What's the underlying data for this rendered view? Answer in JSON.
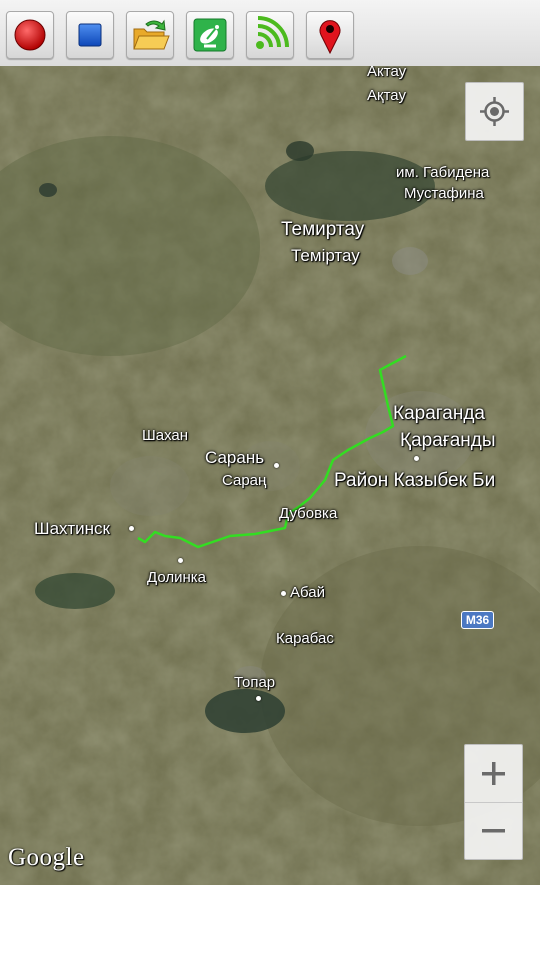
{
  "toolbar": {
    "buttons": [
      {
        "name": "record-button",
        "icon": "record-icon"
      },
      {
        "name": "stop-button",
        "icon": "stop-icon"
      },
      {
        "name": "open-folder-button",
        "icon": "open-folder-icon"
      },
      {
        "name": "satellite-button",
        "icon": "satellite-icon"
      },
      {
        "name": "signal-button",
        "icon": "wifi-signal-icon"
      },
      {
        "name": "location-pin-button",
        "icon": "map-pin-icon"
      }
    ]
  },
  "map": {
    "labels": {
      "aktau_ru": "Актау",
      "aktau_kz": "Ақтау",
      "gabiden_1": "им. Габидена",
      "gabiden_2": "Мустафина",
      "temirtau_ru": "Темиртау",
      "temirtau_kz": "Теміртау",
      "karaganda_ru": "Караганда",
      "karaganda_kz": "Қарағанды",
      "kazybek_bi": "Район Казыбек Би",
      "shakhan": "Шахан",
      "saran_ru": "Сарань",
      "saran_kz": "Сараң",
      "dubovka": "Дубовка",
      "shakhtinsk": "Шахтинск",
      "dolinka": "Долинка",
      "abay": "Абай",
      "karabas": "Карабас",
      "topar": "Топар"
    },
    "road_shield": "M36",
    "attribution": "Google",
    "route_color": "#33dd22"
  },
  "controls": {
    "my_location_icon": "crosshair-location-icon",
    "zoom_in_icon": "plus-icon",
    "zoom_out_icon": "minus-icon"
  }
}
